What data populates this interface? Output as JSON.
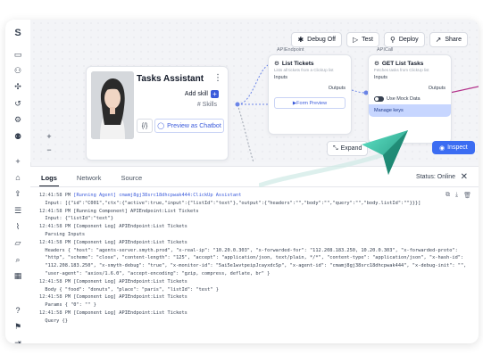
{
  "rail": {
    "icons": [
      "logo-icon",
      "inbox-icon",
      "users-icon",
      "puzzle-icon",
      "history-icon",
      "settings-icon",
      "user-cog-icon",
      "plus-icon",
      "home-icon",
      "upload-icon",
      "database-icon",
      "chart-icon",
      "folder-icon",
      "search-icon",
      "grid-icon",
      "help-icon",
      "flag-icon",
      "collapse-icon"
    ]
  },
  "toolbar": {
    "debug_off": "Debug Off",
    "test": "Test",
    "deploy": "Deploy",
    "share": "Share"
  },
  "agent": {
    "title": "Tasks Assistant",
    "add_skill": "Add skill",
    "skills": "# Skills",
    "code": "{/}",
    "preview": "Preview as Chatbot"
  },
  "node1": {
    "label": "APIEndpoint",
    "title": "List Tickets",
    "desc": "Lists all tickets from a ClickUp list",
    "inputs": "Inputs",
    "outputs": "Outputs",
    "form_preview": "Form Preview"
  },
  "node2": {
    "label": "APICall",
    "title": "GET List Tasks",
    "desc": "Fetches tasks from ClickUp list",
    "inputs": "Inputs",
    "outputs": "Outputs",
    "mock": "Use Mock Data",
    "manage": "Manage keys"
  },
  "canvas_controls": {
    "zoom_in": "+",
    "zoom_out": "−",
    "expand": "Expand",
    "inspect": "Inspect"
  },
  "panel": {
    "tabs": [
      "Logs",
      "Network",
      "Source"
    ],
    "status": "Status: Online",
    "close": "✕"
  },
  "logs": [
    {
      "t": "12:41:58 PM",
      "m": "[Running Agent] cmamj8gj38src18dhcpwak444:ClickUp Assistant",
      "hl": true
    },
    {
      "t": "",
      "m": "  Input: [{\"id\":\"C001\",\"ctx\":{\"active\":true,\"input\":{\"listId\":\"text\"},\"output\":{\"headers\":\"\",\"body\":\"\",\"query\":\"\",\"body.listId\":\"\"}}}]",
      "hl": false
    },
    {
      "t": "12:41:58 PM",
      "m": "[Running Component] APIEndpoint:List Tickets",
      "hl": false
    },
    {
      "t": "",
      "m": "  Input: {\"listId\":\"text\"}",
      "hl": false
    },
    {
      "t": "12:41:58 PM",
      "m": "[Component Log] APIEndpoint:List Tickets",
      "hl": false
    },
    {
      "t": "",
      "m": "  Parsing Inputs",
      "hl": false
    },
    {
      "t": "12:41:58 PM",
      "m": "[Component Log] APIEndpoint:List Tickets",
      "hl": false
    },
    {
      "t": "",
      "m": "  Headers { \"host\": \"agents-server.smyth.prod\", \"x-real-ip\": \"10.20.0.303\", \"x-forwarded-for\": \"112.208.183.250, 10.20.0.303\", \"x-forwarded-proto\":",
      "hl": false
    },
    {
      "t": "",
      "m": "  \"http\", \"scheme\": \"close\", \"content-length\": \"125\", \"accept\": \"application/json, text/plain, */*\", \"content-type\": \"application/json\", \"x-hash-id\":",
      "hl": false
    },
    {
      "t": "",
      "m": "  \"112.208.183.250\", \"x-smyth-debug\": \"true\", \"x-monitor-id\": \"5ai5e1wvtpeipJcayxdcSp\", \"x-agent-id\": \"cmamj8gj38src18dhcpwak444\", \"x-debug-init\": \"\",",
      "hl": false
    },
    {
      "t": "",
      "m": "  \"user-agent\": \"axios/1.6.0\", \"accept-encoding\": \"gzip, compress, deflate, br\" }",
      "hl": false
    },
    {
      "t": "12:41:58 PM",
      "m": "[Component Log] APIEndpoint:List Tickets",
      "hl": false
    },
    {
      "t": "",
      "m": "  Body { \"food\": \"donuts\", \"place\": \"paris\", \"listId\": \"test\" }",
      "hl": false
    },
    {
      "t": "12:41:58 PM",
      "m": "[Component Log] APIEndpoint:List Tickets",
      "hl": false
    },
    {
      "t": "",
      "m": "  Params { \"0\": \"\" }",
      "hl": false
    },
    {
      "t": "12:41:58 PM",
      "m": "[Component Log] APIEndpoint:List Tickets",
      "hl": false
    },
    {
      "t": "",
      "m": "  Query {}",
      "hl": false
    }
  ]
}
